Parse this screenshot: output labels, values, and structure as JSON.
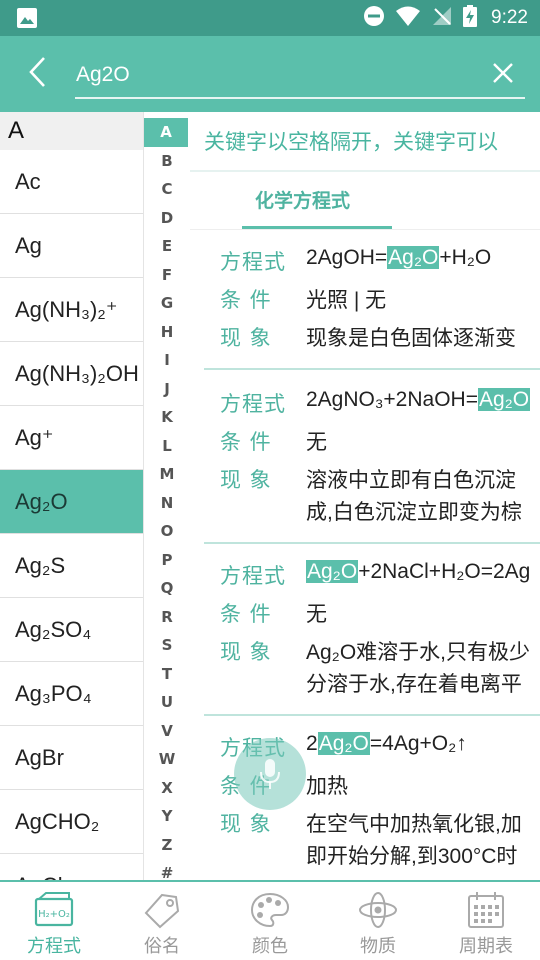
{
  "status_bar": {
    "time": "9:22"
  },
  "search": {
    "query": "Ag2O",
    "placeholder": ""
  },
  "hint": "关键字以空格隔开，关键字可以",
  "tabs": {
    "equation_tab": "化学方程式"
  },
  "formula_list": {
    "section_header": "A",
    "items": [
      "Ac",
      "Ag",
      "Ag(NH₃)₂⁺",
      "Ag(NH₃)₂OH",
      "Ag⁺",
      "Ag₂O",
      "Ag₂S",
      "Ag₂SO₄",
      "Ag₃PO₄",
      "AgBr",
      "AgCHO₂",
      "AgCl"
    ],
    "selected": "Ag₂O"
  },
  "alphabet": [
    "A",
    "B",
    "C",
    "D",
    "E",
    "F",
    "G",
    "H",
    "I",
    "J",
    "K",
    "L",
    "M",
    "N",
    "O",
    "P",
    "Q",
    "R",
    "S",
    "T",
    "U",
    "V",
    "W",
    "X",
    "Y",
    "Z",
    "#"
  ],
  "alphabet_active": "A",
  "labels": {
    "equation": "方程式",
    "condition": "条 件",
    "phenomenon": "现 象"
  },
  "entries": [
    {
      "eq_before": "2AgOH=",
      "eq_hl": "Ag₂O",
      "eq_after": "+H₂O",
      "condition": "光照 | 无",
      "phenomenon_lines": [
        "现象是白色固体逐渐变"
      ]
    },
    {
      "eq_before": "2AgNO₃+2NaOH=",
      "eq_hl": "Ag₂O",
      "eq_after": "",
      "condition": "无",
      "phenomenon_lines": [
        "溶液中立即有白色沉淀",
        "成,白色沉淀立即变为棕"
      ]
    },
    {
      "eq_before": "",
      "eq_hl": "Ag₂O",
      "eq_after": "+2NaCl+H₂O=2Ag",
      "condition": "无",
      "phenomenon_lines": [
        "Ag₂O难溶于水,只有极少",
        "分溶于水,存在着电离平"
      ]
    },
    {
      "eq_before": "2",
      "eq_hl": "Ag₂O",
      "eq_after": "=4Ag+O₂↑",
      "condition": "加热",
      "phenomenon_lines": [
        "在空气中加热氧化银,加",
        "即开始分解,到300°C时"
      ]
    }
  ],
  "bottom_nav": {
    "items": [
      "方程式",
      "俗名",
      "颜色",
      "物质",
      "周期表"
    ],
    "active": "方程式",
    "equation_icon_text": "H₂+O₂"
  },
  "colors": {
    "primary": "#5bbfab",
    "status_bar": "#3f9b8a",
    "accent_text": "#4fb3a0"
  }
}
